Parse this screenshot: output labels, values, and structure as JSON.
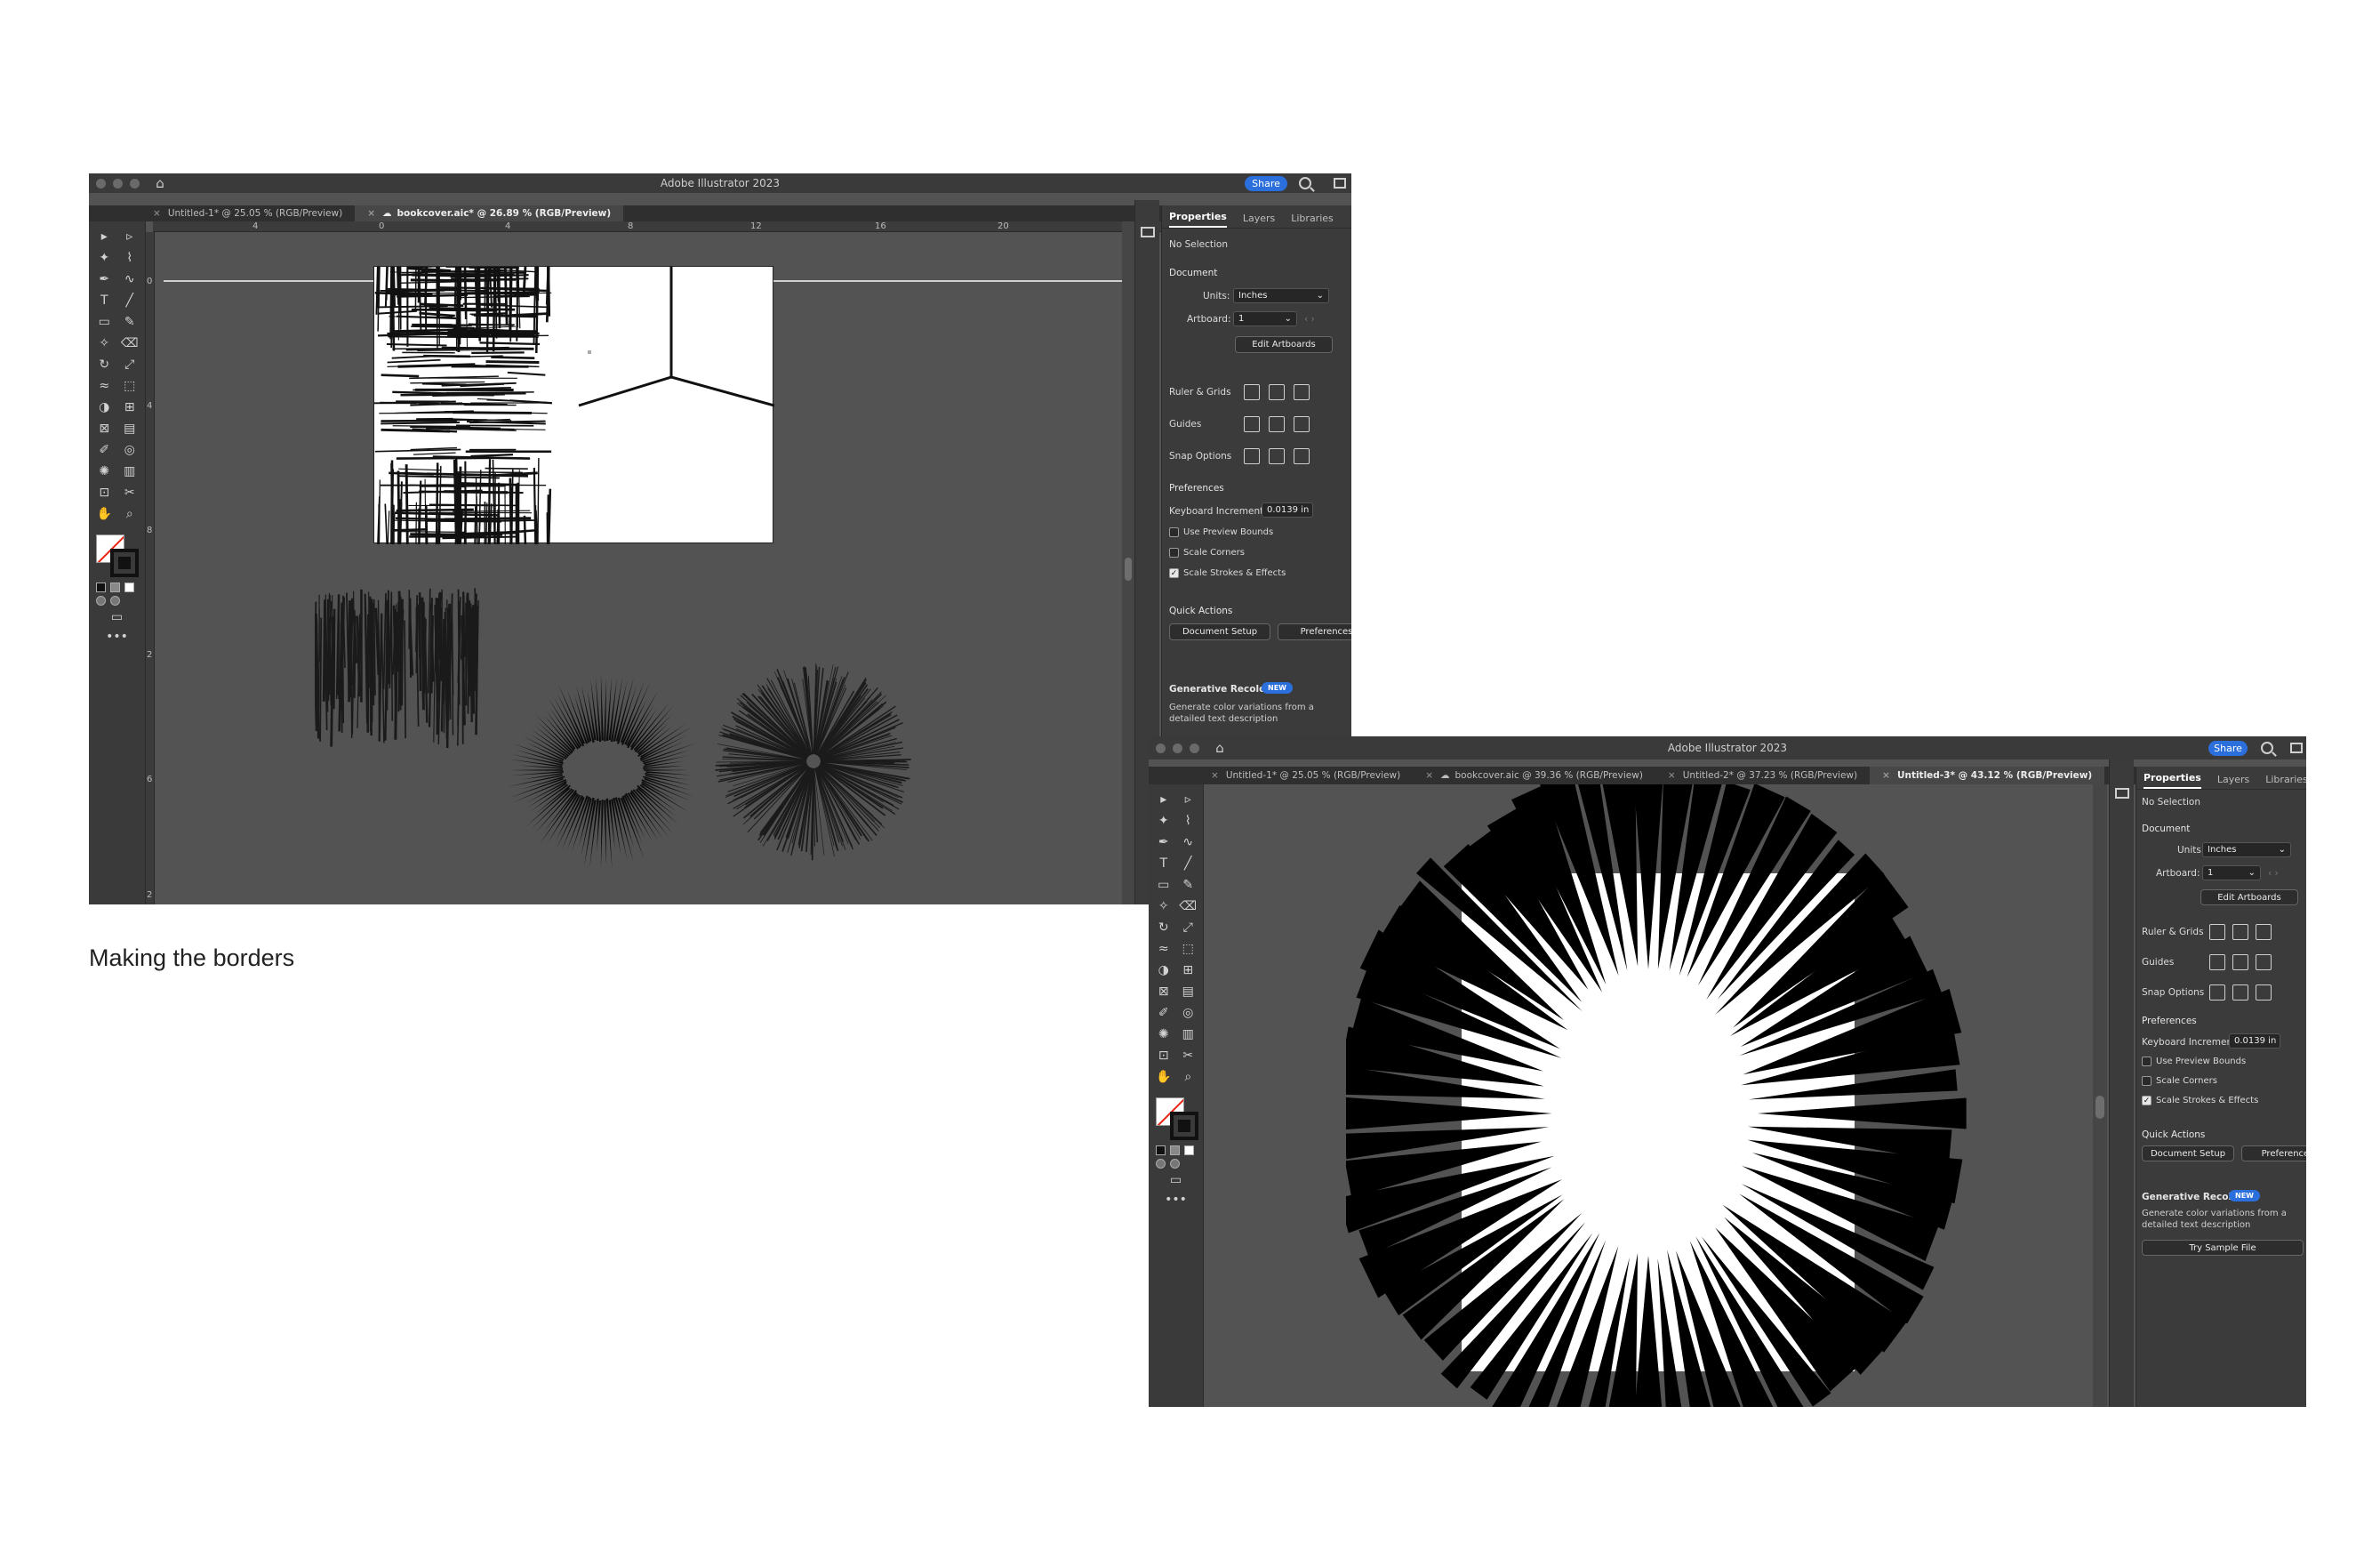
{
  "caption": "Making the borders",
  "windows": [
    {
      "app_title": "Adobe Illustrator 2023",
      "share_label": "Share",
      "tabs": [
        {
          "label": "Untitled-1* @ 25.05 % (RGB/Preview)",
          "active": false,
          "cloud": false
        },
        {
          "label": "bookcover.aic* @ 26.89 % (RGB/Preview)",
          "active": true,
          "cloud": true
        }
      ],
      "ruler_h": [
        "4",
        "0",
        "4",
        "8",
        "12",
        "16",
        "20"
      ],
      "ruler_v": [
        "0",
        "4",
        "8",
        "2",
        "6",
        "2"
      ],
      "panel": {
        "tabs": [
          "Properties",
          "Layers",
          "Libraries"
        ],
        "selection": "No Selection",
        "document_heading": "Document",
        "units_label": "Units:",
        "units_value": "Inches",
        "artboard_label": "Artboard:",
        "artboard_value": "1",
        "edit_artboards": "Edit Artboards",
        "ruler_grids": "Ruler & Grids",
        "guides": "Guides",
        "snap_options": "Snap Options",
        "preferences_heading": "Preferences",
        "keyboard_increment_label": "Keyboard Increment:",
        "keyboard_increment_value": "0.0139 in",
        "use_preview_bounds": "Use Preview Bounds",
        "scale_corners": "Scale Corners",
        "scale_strokes": "Scale Strokes & Effects",
        "quick_actions": "Quick Actions",
        "document_setup": "Document Setup",
        "preferences_btn": "Preferences",
        "generative_recolor": "Generative Recolor",
        "new_badge": "NEW",
        "recolor_desc": "Generate color variations from a detailed text description"
      }
    },
    {
      "app_title": "Adobe Illustrator 2023",
      "share_label": "Share",
      "tabs": [
        {
          "label": "Untitled-1* @ 25.05 % (RGB/Preview)",
          "active": false,
          "cloud": false
        },
        {
          "label": "bookcover.aic @ 39.36 % (RGB/Preview)",
          "active": false,
          "cloud": true
        },
        {
          "label": "Untitled-2* @ 37.23 % (RGB/Preview)",
          "active": false,
          "cloud": false
        },
        {
          "label": "Untitled-3* @ 43.12 % (RGB/Preview)",
          "active": true,
          "cloud": false
        }
      ],
      "panel": {
        "tabs": [
          "Properties",
          "Layers",
          "Libraries"
        ],
        "selection": "No Selection",
        "document_heading": "Document",
        "units_label": "Units:",
        "units_value": "Inches",
        "artboard_label": "Artboard:",
        "artboard_value": "1",
        "edit_artboards": "Edit Artboards",
        "ruler_grids": "Ruler & Grids",
        "guides": "Guides",
        "snap_options": "Snap Options",
        "preferences_heading": "Preferences",
        "keyboard_increment_label": "Keyboard Increment:",
        "keyboard_increment_value": "0.0139 in",
        "use_preview_bounds": "Use Preview Bounds",
        "scale_corners": "Scale Corners",
        "scale_strokes": "Scale Strokes & Effects",
        "quick_actions": "Quick Actions",
        "document_setup": "Document Setup",
        "preferences_btn": "Preferences",
        "generative_recolor": "Generative Recolor",
        "new_badge": "NEW",
        "recolor_desc": "Generate color variations from a detailed text description",
        "try_sample": "Try Sample File"
      }
    }
  ],
  "tool_icons": [
    "selection-tool",
    "direct-selection-tool",
    "magic-wand-tool",
    "lasso-tool",
    "pen-tool",
    "curvature-tool",
    "type-tool",
    "line-tool",
    "rectangle-tool",
    "paintbrush-tool",
    "shaper-tool",
    "eraser-tool",
    "rotate-tool",
    "scale-tool",
    "warp-tool",
    "free-transform-tool",
    "shape-builder-tool",
    "perspective-tool",
    "mesh-tool",
    "gradient-tool",
    "eyedropper-tool",
    "blend-tool",
    "symbol-sprayer-tool",
    "graph-tool",
    "artboard-tool",
    "slice-tool",
    "hand-tool",
    "zoom-tool"
  ],
  "colors": {
    "app_bg": "#535353",
    "chrome": "#3a3a3a",
    "accent": "#2a6fdb"
  }
}
